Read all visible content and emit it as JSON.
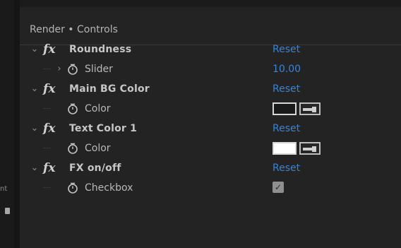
{
  "left_rail": {
    "partial_text": "nt"
  },
  "panel": {
    "title": "Render • Controls"
  },
  "effects": [
    {
      "name": "Roundness",
      "reset_label": "Reset",
      "child": {
        "name": "Slider",
        "value": "10.00",
        "type": "slider"
      }
    },
    {
      "name": "Main BG Color",
      "reset_label": "Reset",
      "child": {
        "name": "Color",
        "type": "color",
        "swatch_color": "#1a1a1a"
      }
    },
    {
      "name": "Text Color 1",
      "reset_label": "Reset",
      "child": {
        "name": "Color",
        "type": "color",
        "swatch_color": "#ffffff"
      }
    },
    {
      "name": "FX on/off",
      "reset_label": "Reset",
      "child": {
        "name": "Checkbox",
        "type": "checkbox",
        "checked": true
      }
    }
  ],
  "icons": {
    "expand_open": "chevron-down-icon",
    "expand_closed": "chevron-right-icon",
    "effect": "fx-icon",
    "stopwatch": "stopwatch-icon",
    "eyedropper": "eyedropper-icon",
    "check": "checkmark-icon"
  },
  "colors": {
    "link": "#3b83d6",
    "panel_bg": "#232323"
  }
}
